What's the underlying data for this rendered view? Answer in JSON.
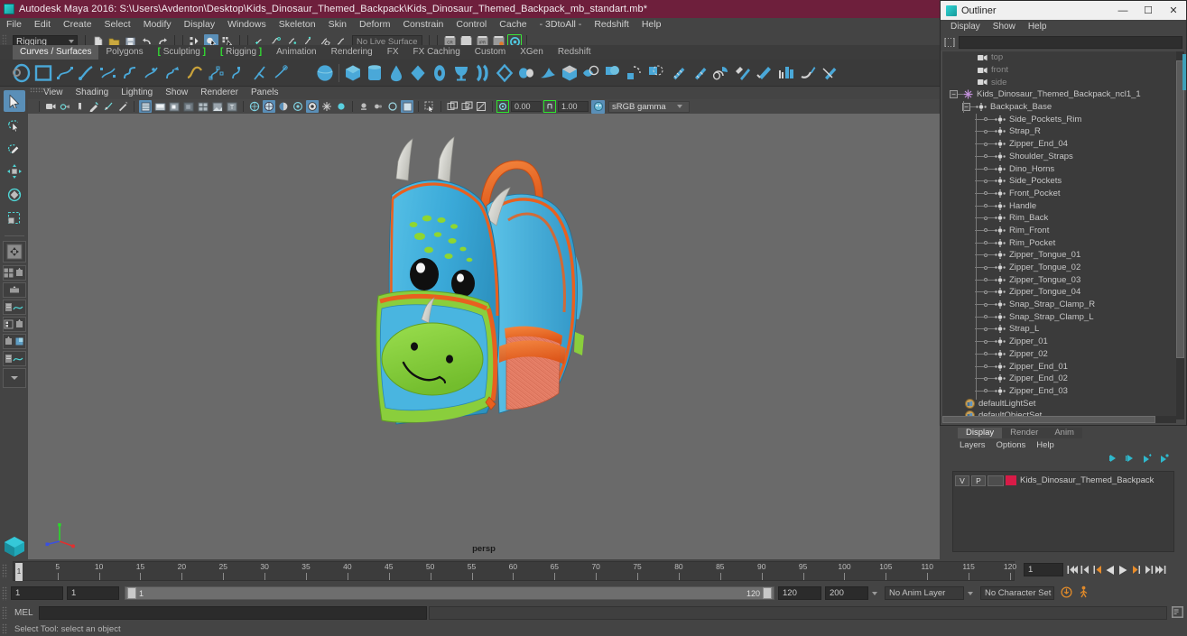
{
  "titlebar": {
    "icon": "maya-logo-icon",
    "title": "Autodesk Maya 2016: S:\\Users\\Avdenton\\Desktop\\Kids_Dinosaur_Themed_Backpack\\Kids_Dinosaur_Themed_Backpack_mb_standart.mb*"
  },
  "menubar": {
    "items": [
      "File",
      "Edit",
      "Create",
      "Select",
      "Modify",
      "Display",
      "Windows",
      "Skeleton",
      "Skin",
      "Deform",
      "Constrain",
      "Control",
      "Cache",
      "- 3DtoAll -",
      "Redshift",
      "Help"
    ]
  },
  "statusline": {
    "mode": "Rigging",
    "live_surface": "No Live Surface",
    "icons": [
      "new-scene-icon",
      "open-scene-icon",
      "save-scene-icon",
      "undo-icon",
      "redo-icon",
      "select-by-hierarchy-icon",
      "select-by-object-icon",
      "select-by-component-icon",
      "snap-to-grid-icon",
      "snap-to-curve-icon",
      "snap-to-point-icon",
      "snap-to-projected-center-icon",
      "snap-to-view-plane-icon",
      "make-live-icon",
      "render-current-frame-icon",
      "ipr-render-icon",
      "render-settings-icon",
      "hypershade-icon",
      "render-view-icon"
    ]
  },
  "shelf": {
    "tabs": [
      {
        "label": "Curves / Surfaces",
        "active": true,
        "bracket": false
      },
      {
        "label": "Polygons",
        "active": false,
        "bracket": false
      },
      {
        "label": "Sculpting",
        "active": false,
        "bracket": true
      },
      {
        "label": "Rigging",
        "active": false,
        "bracket": true
      },
      {
        "label": "Animation",
        "active": false,
        "bracket": false
      },
      {
        "label": "Rendering",
        "active": false,
        "bracket": false
      },
      {
        "label": "FX",
        "active": false,
        "bracket": false
      },
      {
        "label": "FX Caching",
        "active": false,
        "bracket": false
      },
      {
        "label": "Custom",
        "active": false,
        "bracket": false
      },
      {
        "label": "XGen",
        "active": false,
        "bracket": false
      },
      {
        "label": "Redshift",
        "active": false,
        "bracket": false
      }
    ],
    "icon_names": [
      "nurbs-circle-icon",
      "nurbs-square-icon",
      "cv-curve-tool-icon",
      "pencil-curve-tool-icon",
      "ep-curve-tool-icon",
      "bezier-curve-icon",
      "add-points-tool-icon",
      "curve-editing-tool-icon",
      "attach-curves-icon",
      "detach-curves-icon",
      "insert-knot-icon",
      "offset-curve-icon",
      "rebuild-curve-icon",
      "cut-curve-icon",
      "curve-fillet-icon",
      "nurbs-sphere-icon",
      "nurbs-cube-icon",
      "nurbs-cylinder-icon",
      "nurbs-cone-icon",
      "nurbs-plane-icon",
      "nurbs-torus-icon",
      "revolve-icon",
      "loft-icon",
      "planar-icon",
      "extrude-icon",
      "birail-icon",
      "boundary-icon",
      "square-surface-icon",
      "bevel-icon",
      "bevel-plus-icon",
      "intersect-surfaces-icon",
      "project-curve-icon",
      "trim-tool-icon",
      "untrim-surfaces-icon",
      "attach-surfaces-icon",
      "detach-surfaces-icon",
      "align-surfaces-icon",
      "insert-isoparms-icon",
      "sculpt-geometry-tool-icon",
      "surface-fillet-icon"
    ]
  },
  "toolbox": {
    "items": [
      {
        "name": "select-tool",
        "selected": true
      },
      {
        "name": "lasso-select-tool",
        "selected": false
      },
      {
        "name": "paint-select-tool",
        "selected": false
      },
      {
        "name": "move-tool",
        "selected": false
      },
      {
        "name": "rotate-tool",
        "selected": false
      },
      {
        "name": "scale-tool",
        "selected": false
      },
      {
        "name": "last-tool-used",
        "selected": false
      }
    ],
    "layout_buttons": [
      "single-perspective-view-layout",
      "four-view-layout",
      "persp-outliner-layout",
      "persp-graph-editor-layout",
      "two-pane-side-layout",
      "outliner-persp-layout",
      "more-layouts-dropdown"
    ]
  },
  "viewport": {
    "panel_menus": [
      "View",
      "Shading",
      "Lighting",
      "Show",
      "Renderer",
      "Panels"
    ],
    "camera_label": "persp",
    "toolbar_icons": [
      "select-camera-icon",
      "bookmark-icon",
      "image-plane-icon",
      "two-d-pan-zoom-icon",
      "grease-pencil-icon",
      "ipr-icon",
      "wireframe-icon",
      "smooth-shade-all-icon",
      "smooth-shade-selected-icon",
      "flat-shade-icon",
      "wireframe-on-shaded-icon",
      "texture-icon",
      "use-all-lights-icon",
      "shadows-icon",
      "screen-space-ao-icon",
      "motion-blur-icon",
      "multisample-anti-aliasing-icon",
      "depth-of-field-icon",
      "isolate-select-icon",
      "xray-icon",
      "xray-joints-icon",
      "exposure-icon",
      "gamma-icon"
    ],
    "exposure_value": "0.00",
    "gamma_value": "1.00",
    "color_management": "sRGB gamma"
  },
  "model": {
    "name": "Kids Dinosaur Themed Backpack",
    "colors": {
      "body_blue": "#3aa9d8",
      "body_blue_light": "#59c2e8",
      "body_blue_dark": "#2b8cb8",
      "trim_orange": "#e8601f",
      "trim_orange_light": "#f07a3a",
      "pocket_green": "#7dc832",
      "pocket_green_light": "#95d94a",
      "horn_grey": "#d8d8d2",
      "mesh_salmon": "#e8836a",
      "eye_black": "#101010",
      "spots_green": "#8fd630",
      "viewport_bg": "#6a6a6a"
    }
  },
  "outliner": {
    "title": "Outliner",
    "window_buttons": [
      "minimize-button",
      "maximize-button",
      "close-button"
    ],
    "menus": [
      "Display",
      "Show",
      "Help"
    ],
    "search_value": "",
    "items": [
      {
        "label": "top",
        "depth": 1,
        "icon": "camera-icon",
        "dim": true,
        "expander": null
      },
      {
        "label": "front",
        "depth": 1,
        "icon": "camera-icon",
        "dim": true,
        "expander": null
      },
      {
        "label": "side",
        "depth": 1,
        "icon": "camera-icon",
        "dim": true,
        "expander": null
      },
      {
        "label": "Kids_Dinosaur_Themed_Backpack_ncl1_1",
        "depth": 0,
        "icon": "transform-group-icon",
        "dim": false,
        "expander": "minus"
      },
      {
        "label": "Backpack_Base",
        "depth": 1,
        "icon": "mesh-icon",
        "dim": false,
        "expander": "minus"
      },
      {
        "label": "Side_Pockets_Rim",
        "depth": 2,
        "icon": "mesh-icon",
        "dim": false,
        "expander": null
      },
      {
        "label": "Strap_R",
        "depth": 2,
        "icon": "mesh-icon",
        "dim": false,
        "expander": null
      },
      {
        "label": "Zipper_End_04",
        "depth": 2,
        "icon": "mesh-icon",
        "dim": false,
        "expander": null
      },
      {
        "label": "Shoulder_Straps",
        "depth": 2,
        "icon": "mesh-icon",
        "dim": false,
        "expander": null
      },
      {
        "label": "Dino_Horns",
        "depth": 2,
        "icon": "mesh-icon",
        "dim": false,
        "expander": null
      },
      {
        "label": "Side_Pockets",
        "depth": 2,
        "icon": "mesh-icon",
        "dim": false,
        "expander": null
      },
      {
        "label": "Front_Pocket",
        "depth": 2,
        "icon": "mesh-icon",
        "dim": false,
        "expander": null
      },
      {
        "label": "Handle",
        "depth": 2,
        "icon": "mesh-icon",
        "dim": false,
        "expander": null
      },
      {
        "label": "Rim_Back",
        "depth": 2,
        "icon": "mesh-icon",
        "dim": false,
        "expander": null
      },
      {
        "label": "Rim_Front",
        "depth": 2,
        "icon": "mesh-icon",
        "dim": false,
        "expander": null
      },
      {
        "label": "Rim_Pocket",
        "depth": 2,
        "icon": "mesh-icon",
        "dim": false,
        "expander": null
      },
      {
        "label": "Zipper_Tongue_01",
        "depth": 2,
        "icon": "mesh-icon",
        "dim": false,
        "expander": null
      },
      {
        "label": "Zipper_Tongue_02",
        "depth": 2,
        "icon": "mesh-icon",
        "dim": false,
        "expander": null
      },
      {
        "label": "Zipper_Tongue_03",
        "depth": 2,
        "icon": "mesh-icon",
        "dim": false,
        "expander": null
      },
      {
        "label": "Zipper_Tongue_04",
        "depth": 2,
        "icon": "mesh-icon",
        "dim": false,
        "expander": null
      },
      {
        "label": "Snap_Strap_Clamp_R",
        "depth": 2,
        "icon": "mesh-icon",
        "dim": false,
        "expander": null
      },
      {
        "label": "Snap_Strap_Clamp_L",
        "depth": 2,
        "icon": "mesh-icon",
        "dim": false,
        "expander": null
      },
      {
        "label": "Strap_L",
        "depth": 2,
        "icon": "mesh-icon",
        "dim": false,
        "expander": null
      },
      {
        "label": "Zipper_01",
        "depth": 2,
        "icon": "mesh-icon",
        "dim": false,
        "expander": null
      },
      {
        "label": "Zipper_02",
        "depth": 2,
        "icon": "mesh-icon",
        "dim": false,
        "expander": null
      },
      {
        "label": "Zipper_End_01",
        "depth": 2,
        "icon": "mesh-icon",
        "dim": false,
        "expander": null
      },
      {
        "label": "Zipper_End_02",
        "depth": 2,
        "icon": "mesh-icon",
        "dim": false,
        "expander": null
      },
      {
        "label": "Zipper_End_03",
        "depth": 2,
        "icon": "mesh-icon",
        "dim": false,
        "expander": null
      },
      {
        "label": "defaultLightSet",
        "depth": 0,
        "icon": "set-icon",
        "dim": false,
        "expander": null
      },
      {
        "label": "defaultObjectSet",
        "depth": 0,
        "icon": "set-icon",
        "dim": false,
        "expander": null
      }
    ]
  },
  "layer_editor": {
    "tabs": [
      {
        "label": "Display",
        "active": true
      },
      {
        "label": "Render",
        "active": false
      },
      {
        "label": "Anim",
        "active": false
      }
    ],
    "menus": [
      "Layers",
      "Options",
      "Help"
    ],
    "toolbar_icons": [
      "move-layer-up-icon",
      "move-layer-down-icon",
      "new-layer-icon",
      "new-layer-from-selected-icon"
    ],
    "layers": [
      {
        "visibility": "V",
        "playback": "P",
        "shading": "",
        "color": "#d81b47",
        "name": "Kids_Dinosaur_Themed_Backpack"
      }
    ]
  },
  "timeslider": {
    "ticks": [
      5,
      10,
      15,
      20,
      25,
      30,
      35,
      40,
      45,
      50,
      55,
      60,
      65,
      70,
      75,
      80,
      85,
      90,
      95,
      100,
      105,
      110,
      115,
      120
    ],
    "start": 1,
    "end": 120,
    "current_frame": "1",
    "playback_buttons": [
      "go-to-start-icon",
      "step-back-keyframe-icon",
      "step-back-frame-icon",
      "play-backwards-icon",
      "play-forwards-icon",
      "step-forward-frame-icon",
      "step-forward-keyframe-icon",
      "go-to-end-icon"
    ]
  },
  "rangeslider": {
    "anim_start": "1",
    "anim_end": "1",
    "range_start": "1",
    "range_end": "120",
    "playback_end": "120",
    "anim_end_field": "200",
    "anim_layer": "No Anim Layer",
    "character_set": "No Character Set",
    "right_icons": [
      "auto-keyframe-icon",
      "animation-preferences-icon"
    ]
  },
  "commandline": {
    "language": "MEL",
    "input_value": "",
    "output_value": "",
    "script_editor_icon": "script-editor-icon"
  },
  "helpline": {
    "text": "Select Tool: select an object"
  }
}
